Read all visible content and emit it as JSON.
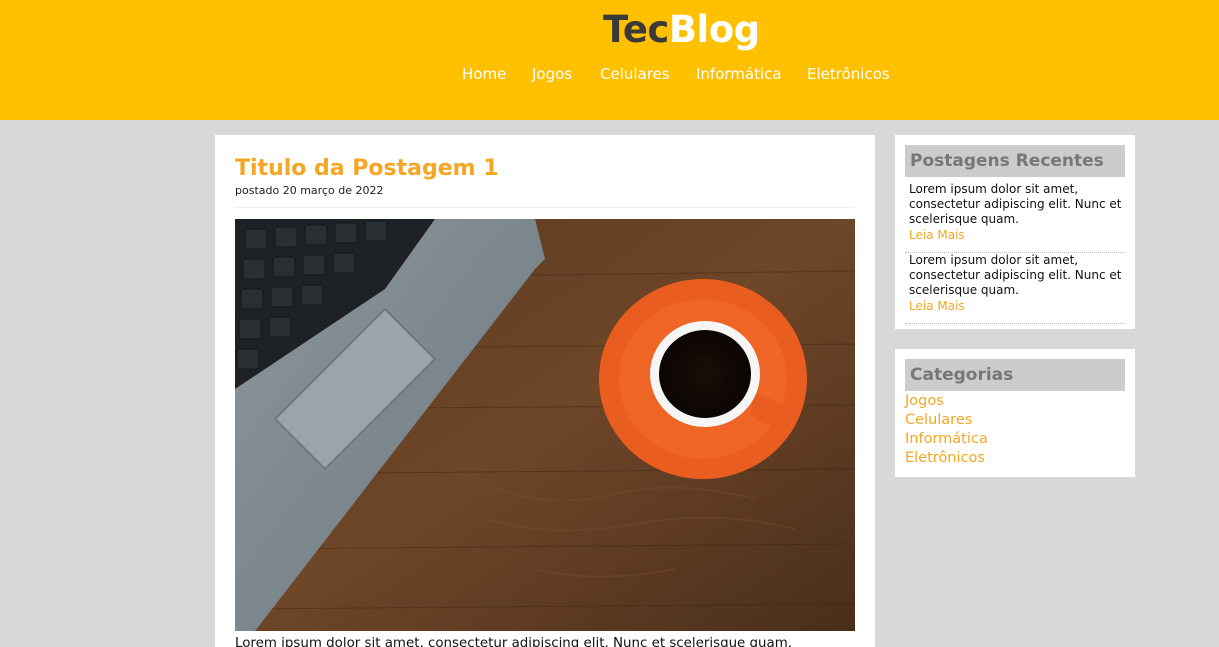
{
  "header": {
    "logo_part1": "Tec",
    "logo_part2": "Blog",
    "nav": [
      "Home",
      "Jogos",
      "Celulares",
      "Informática",
      "Eletrônicos"
    ]
  },
  "post": {
    "title": "Titulo da Postagem 1",
    "date": "postado 20 março de 2022",
    "excerpt": "Lorem ipsum dolor sit amet, consectetur adipiscing elit. Nunc et scelerisque quam."
  },
  "recent": {
    "title": "Postagens Recentes",
    "items": [
      {
        "text": "Lorem ipsum dolor sit amet, consectetur adipiscing elit. Nunc et scelerisque quam.",
        "link": "Leia Mais"
      },
      {
        "text": "Lorem ipsum dolor sit amet, consectetur adipiscing elit. Nunc et scelerisque quam.",
        "link": "Leia Mais"
      }
    ]
  },
  "categories": {
    "title": "Categorias",
    "items": [
      "Jogos",
      "Celulares",
      "Informática",
      "Eletrônicos"
    ]
  },
  "colors": {
    "header_bg": "#ffc000",
    "accent": "#f5a623",
    "page_bg": "#d8d8d8"
  }
}
